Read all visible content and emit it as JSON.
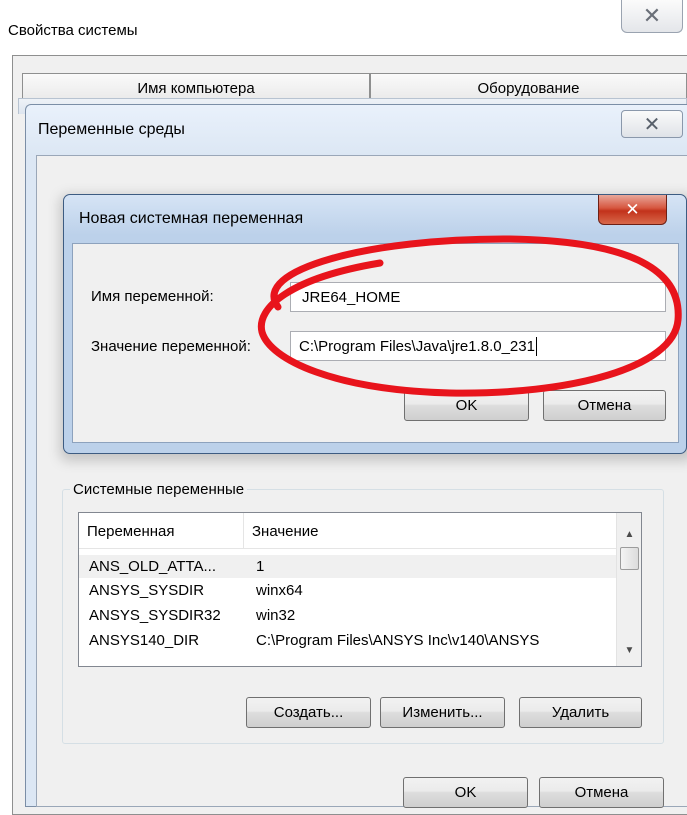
{
  "system_properties": {
    "title": "Свойства системы",
    "close_glyph": "✕",
    "tabs": [
      {
        "label": "Имя компьютера"
      },
      {
        "label": "Оборудование"
      }
    ]
  },
  "environment_variables": {
    "title": "Переменные среды",
    "close_glyph": "✕",
    "system_variables": {
      "legend": "Системные переменные",
      "columns": [
        "Переменная",
        "Значение"
      ],
      "rows": [
        {
          "name": "ANS_OLD_ATTA...",
          "value": "1",
          "selected": true
        },
        {
          "name": "ANSYS_SYSDIR",
          "value": "winx64"
        },
        {
          "name": "ANSYS_SYSDIR32",
          "value": "win32"
        },
        {
          "name": "ANSYS140_DIR",
          "value": "C:\\Program Files\\ANSYS Inc\\v140\\ANSYS"
        }
      ]
    },
    "buttons": {
      "create": "Создать...",
      "edit": "Изменить...",
      "delete": "Удалить",
      "ok": "OK",
      "cancel": "Отмена"
    }
  },
  "new_variable_dialog": {
    "title": "Новая системная переменная",
    "close_glyph": "✕",
    "name_label": "Имя переменной:",
    "value_label": "Значение переменной:",
    "name_value": "JRE64_HOME",
    "value_value": "C:\\Program Files\\Java\\jre1.8.0_231",
    "ok_label": "OK",
    "cancel_label": "Отмена"
  },
  "colors": {
    "highlight": "#e8141c",
    "selected_row": "#f0f0f0",
    "close_red": "#c2321b"
  }
}
